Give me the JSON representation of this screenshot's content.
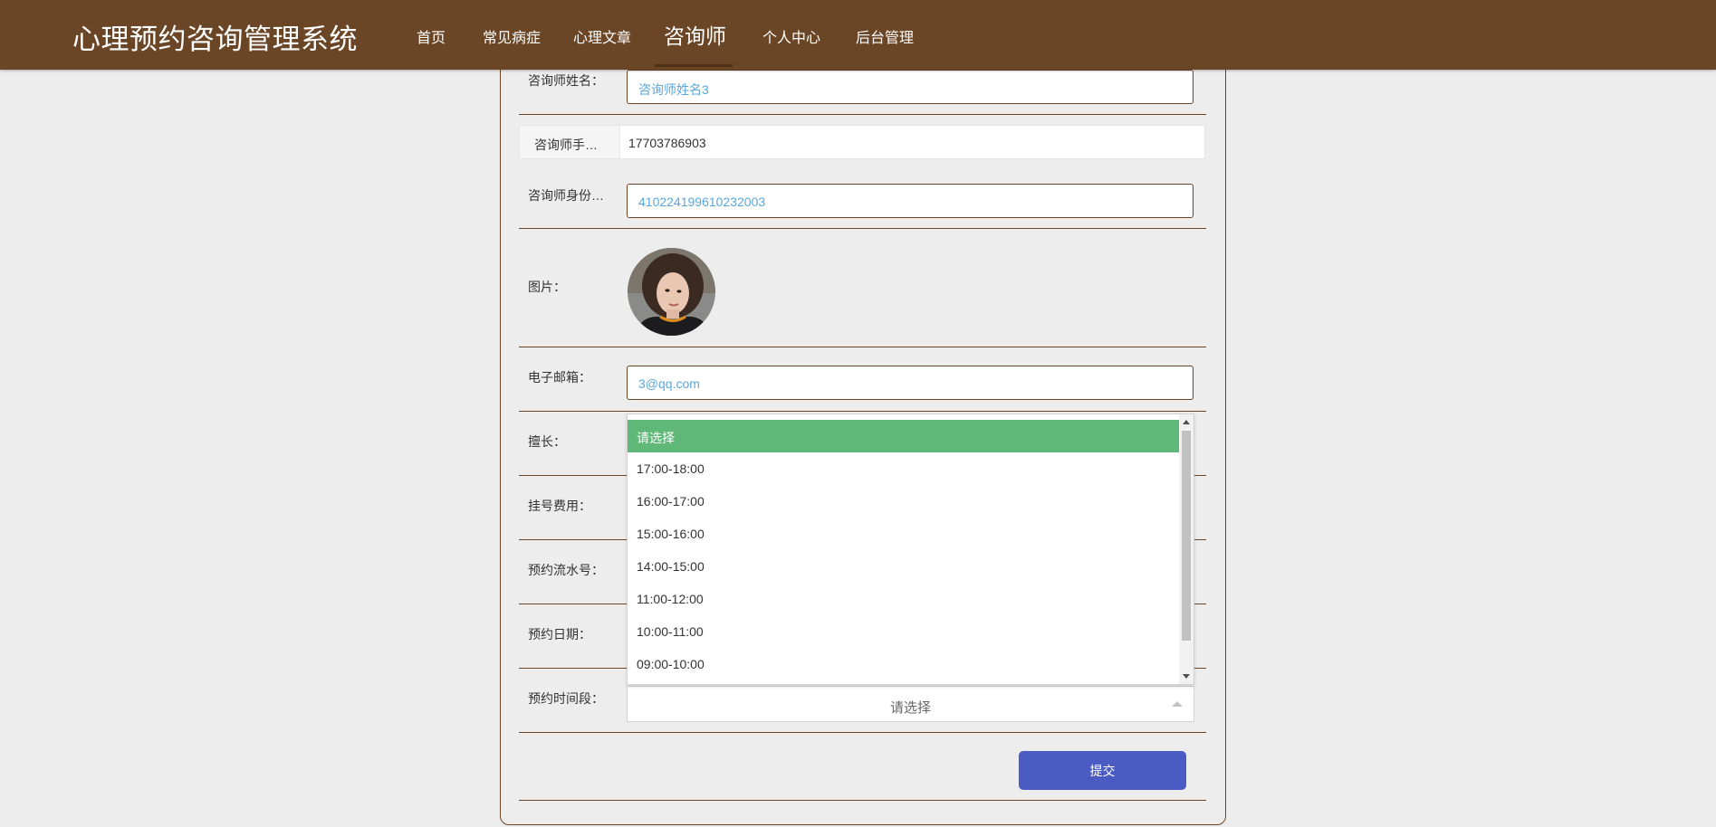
{
  "header": {
    "title": "心理预约咨询管理系统",
    "nav": [
      {
        "label": "首页"
      },
      {
        "label": "常见病症"
      },
      {
        "label": "心理文章"
      },
      {
        "label": "咨询师",
        "active": true
      },
      {
        "label": "个人中心"
      },
      {
        "label": "后台管理"
      }
    ]
  },
  "form": {
    "name": {
      "label": "咨询师姓名：",
      "value": "咨询师姓名3"
    },
    "phone": {
      "label": "咨询师手…",
      "value": "17703786903"
    },
    "id_card": {
      "label": "咨询师身份…",
      "value": "410224199610232003"
    },
    "photo": {
      "label": "图片："
    },
    "email": {
      "label": "电子邮箱：",
      "value": "3@qq.com"
    },
    "specialty": {
      "label": "擅长："
    },
    "fee": {
      "label": "挂号费用："
    },
    "serial": {
      "label": "预约流水号："
    },
    "date": {
      "label": "预约日期："
    },
    "time_slot": {
      "label": "预约时间段：",
      "placeholder": "请选择",
      "options": [
        "请选择",
        "17:00-18:00",
        "16:00-17:00",
        "15:00-16:00",
        "14:00-15:00",
        "11:00-12:00",
        "10:00-11:00",
        "09:00-10:00"
      ],
      "highlighted": "请选择"
    },
    "submit_label": "提交"
  },
  "colors": {
    "header_bg": "#6b4626",
    "accent_border": "#6b4626",
    "input_text": "#5aa7dd",
    "option_selected": "#5fb878",
    "submit_bg": "#4b5bc4"
  }
}
